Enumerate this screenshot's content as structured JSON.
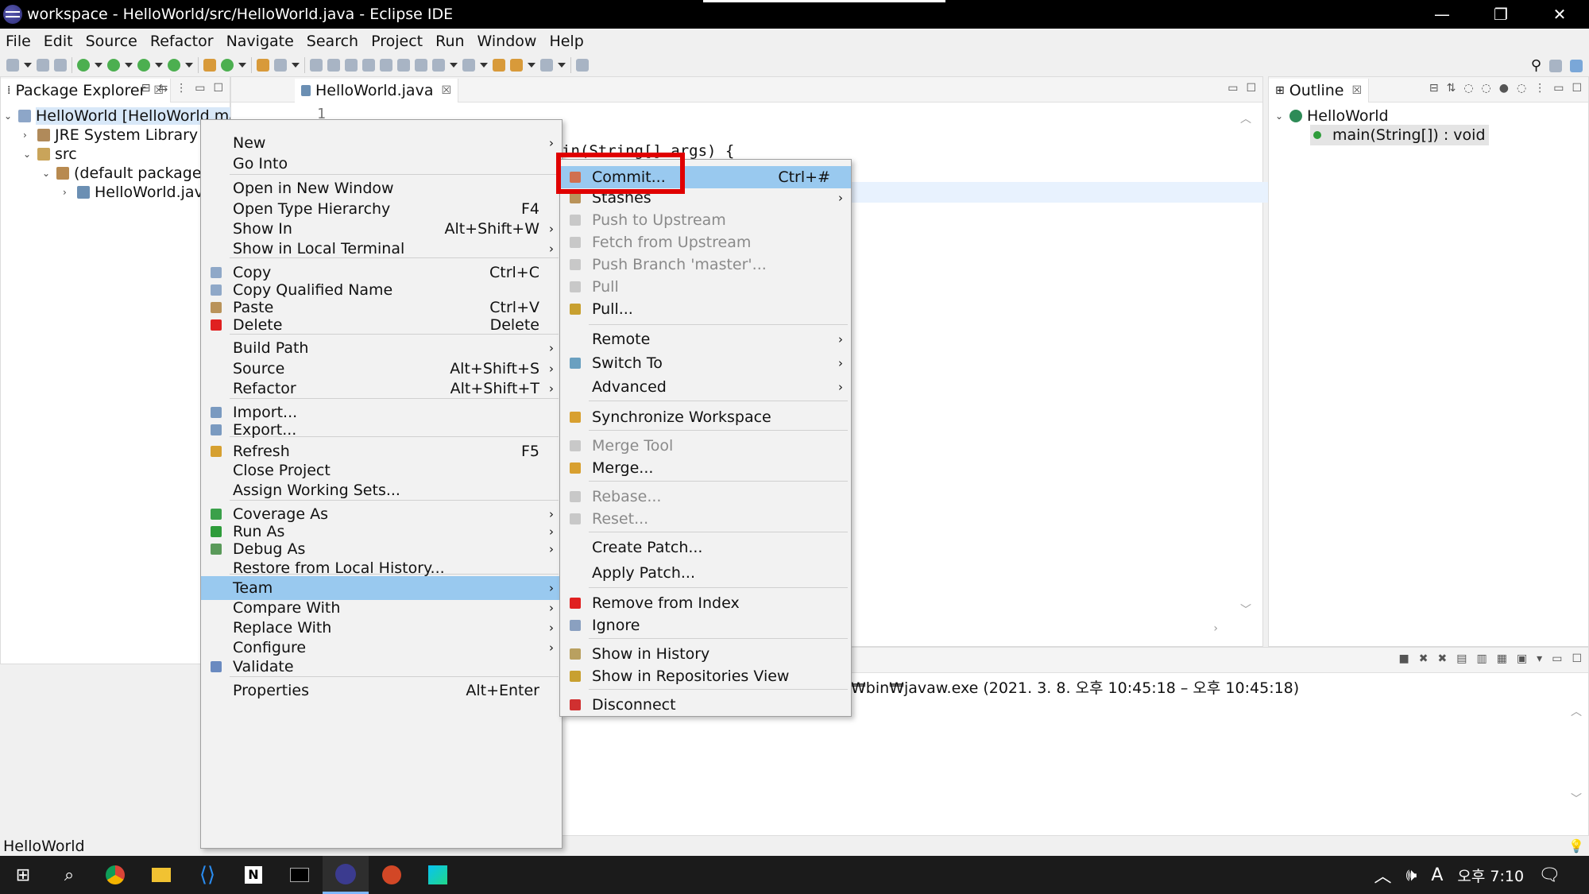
{
  "window": {
    "title": "workspace - HelloWorld/src/HelloWorld.java - Eclipse IDE",
    "controls": [
      "—",
      "❐",
      "✕"
    ]
  },
  "menubar": [
    "File",
    "Edit",
    "Source",
    "Refactor",
    "Navigate",
    "Search",
    "Project",
    "Run",
    "Window",
    "Help"
  ],
  "package_explorer": {
    "tab_label": "Package Explorer",
    "tree": [
      {
        "label": "HelloWorld [HelloWorld master]",
        "icon": "project-icon"
      },
      {
        "label": "JRE System Library [J",
        "icon": "library-icon"
      },
      {
        "label": "src",
        "icon": "source-folder-icon"
      },
      {
        "label": "(default package)",
        "icon": "package-icon"
      },
      {
        "label": "HelloWorld.java",
        "icon": "java-file-icon"
      }
    ]
  },
  "editor": {
    "tab_label": "HelloWorld.java",
    "line_number": "1",
    "code_fragment": "in(String[] args) {"
  },
  "outline": {
    "tab_label": "Outline",
    "class_name": "HelloWorld",
    "method": "main(String[]) : void"
  },
  "console": {
    "header_text": "₩bin₩javaw.exe  (2021. 3. 8. 오후 10:45:18 – 오후 10:45:18)"
  },
  "context_menu": [
    {
      "label": "New",
      "shortcut": "",
      "submenu": true
    },
    {
      "label": "Go Into",
      "shortcut": "",
      "submenu": false
    },
    {
      "label": "Open in New Window",
      "shortcut": "",
      "submenu": false
    },
    {
      "label": "Open Type Hierarchy",
      "shortcut": "F4",
      "submenu": false
    },
    {
      "label": "Show In",
      "shortcut": "Alt+Shift+W",
      "submenu": true
    },
    {
      "label": "Show in Local Terminal",
      "shortcut": "",
      "submenu": true
    },
    {
      "label": "Copy",
      "shortcut": "Ctrl+C",
      "submenu": false
    },
    {
      "label": "Copy Qualified Name",
      "shortcut": "",
      "submenu": false
    },
    {
      "label": "Paste",
      "shortcut": "Ctrl+V",
      "submenu": false
    },
    {
      "label": "Delete",
      "shortcut": "Delete",
      "submenu": false
    },
    {
      "label": "Build Path",
      "shortcut": "",
      "submenu": true
    },
    {
      "label": "Source",
      "shortcut": "Alt+Shift+S",
      "submenu": true
    },
    {
      "label": "Refactor",
      "shortcut": "Alt+Shift+T",
      "submenu": true
    },
    {
      "label": "Import...",
      "shortcut": "",
      "submenu": false
    },
    {
      "label": "Export...",
      "shortcut": "",
      "submenu": false
    },
    {
      "label": "Refresh",
      "shortcut": "F5",
      "submenu": false
    },
    {
      "label": "Close Project",
      "shortcut": "",
      "submenu": false
    },
    {
      "label": "Assign Working Sets...",
      "shortcut": "",
      "submenu": false
    },
    {
      "label": "Coverage As",
      "shortcut": "",
      "submenu": true
    },
    {
      "label": "Run As",
      "shortcut": "",
      "submenu": true
    },
    {
      "label": "Debug As",
      "shortcut": "",
      "submenu": true
    },
    {
      "label": "Restore from Local History...",
      "shortcut": "",
      "submenu": false
    },
    {
      "label": "Team",
      "shortcut": "",
      "submenu": true,
      "highlighted": true
    },
    {
      "label": "Compare With",
      "shortcut": "",
      "submenu": true
    },
    {
      "label": "Replace With",
      "shortcut": "",
      "submenu": true
    },
    {
      "label": "Configure",
      "shortcut": "",
      "submenu": true
    },
    {
      "label": "Validate",
      "shortcut": "",
      "submenu": false
    },
    {
      "label": "Properties",
      "shortcut": "Alt+Enter",
      "submenu": false
    }
  ],
  "team_menu": [
    {
      "label": "Commit...",
      "shortcut": "Ctrl+#",
      "highlighted": true
    },
    {
      "label": "Stashes",
      "submenu": true
    },
    {
      "label": "Push to Upstream",
      "disabled": true
    },
    {
      "label": "Fetch from Upstream",
      "disabled": true
    },
    {
      "label": "Push Branch 'master'...",
      "disabled": true
    },
    {
      "label": "Pull",
      "disabled": true
    },
    {
      "label": "Pull..."
    },
    {
      "label": "Remote",
      "submenu": true
    },
    {
      "label": "Switch To",
      "submenu": true
    },
    {
      "label": "Advanced",
      "submenu": true
    },
    {
      "label": "Synchronize Workspace"
    },
    {
      "label": "Merge Tool",
      "disabled": true
    },
    {
      "label": "Merge..."
    },
    {
      "label": "Rebase...",
      "disabled": true
    },
    {
      "label": "Reset...",
      "disabled": true
    },
    {
      "label": "Create Patch..."
    },
    {
      "label": "Apply Patch..."
    },
    {
      "label": "Remove from Index"
    },
    {
      "label": "Ignore"
    },
    {
      "label": "Show in History"
    },
    {
      "label": "Show in Repositories View"
    },
    {
      "label": "Disconnect"
    }
  ],
  "status_bar": {
    "selection": "HelloWorld"
  },
  "taskbar": {
    "clock": "오후 7:10",
    "ime": "A",
    "apps": [
      "windows-start-icon",
      "search-icon",
      "chrome-icon",
      "file-explorer-icon",
      "vscode-icon",
      "notion-icon",
      "terminal-icon",
      "eclipse-icon",
      "powerpoint-icon",
      "webstorm-icon"
    ]
  },
  "colors": {
    "highlight": "#99c9ef",
    "annotation_box": "#e00000",
    "titlebar": "#000000"
  }
}
